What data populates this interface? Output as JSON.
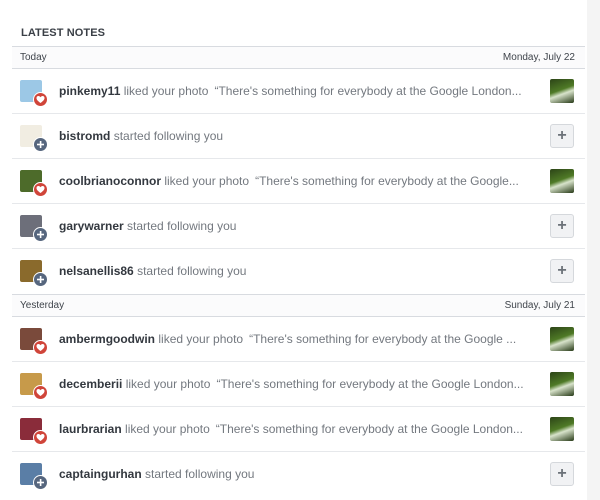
{
  "header": {
    "title": "LATEST NOTES"
  },
  "sections": [
    {
      "label": "Today",
      "date": "Monday, July 22",
      "notes": [
        {
          "username": "pinkemy11",
          "action": "liked your photo",
          "quote": "“There's something for everybody at the Google London...",
          "type": "like",
          "avatar_color": "#9cc8e6"
        },
        {
          "username": "bistromd",
          "action": "started following you",
          "quote": "",
          "type": "follow",
          "avatar_color": "#f1ede2"
        },
        {
          "username": "coolbrianoconnor",
          "action": "liked your photo",
          "quote": "“There's something for everybody at the Google...",
          "type": "like",
          "avatar_color": "#4d6b2a"
        },
        {
          "username": "garywarner",
          "action": "started following you",
          "quote": "",
          "type": "follow",
          "avatar_color": "#6d6f7a"
        },
        {
          "username": "nelsanellis86",
          "action": "started following you",
          "quote": "",
          "type": "follow",
          "avatar_color": "#8a6a2c"
        }
      ]
    },
    {
      "label": "Yesterday",
      "date": "Sunday, July 21",
      "notes": [
        {
          "username": "ambermgoodwin",
          "action": "liked your photo",
          "quote": "“There's something for everybody at the Google ...",
          "type": "like",
          "avatar_color": "#7a4a3b"
        },
        {
          "username": "decemberii",
          "action": "liked your photo",
          "quote": "“There's something for everybody at the Google London...",
          "type": "like",
          "avatar_color": "#c79a4a"
        },
        {
          "username": "laurbrarian",
          "action": "liked your photo",
          "quote": "“There's something for everybody at the Google London...",
          "type": "like",
          "avatar_color": "#8a2c3a"
        },
        {
          "username": "captaingurhan",
          "action": "started following you",
          "quote": "",
          "type": "follow",
          "avatar_color": "#5a7ea6"
        }
      ]
    }
  ],
  "follow_button_label": "+",
  "colors": {
    "like_badge": "#d0453a",
    "follow_badge": "#56667e",
    "username": "#33383f",
    "meta_text": "#73787f"
  }
}
